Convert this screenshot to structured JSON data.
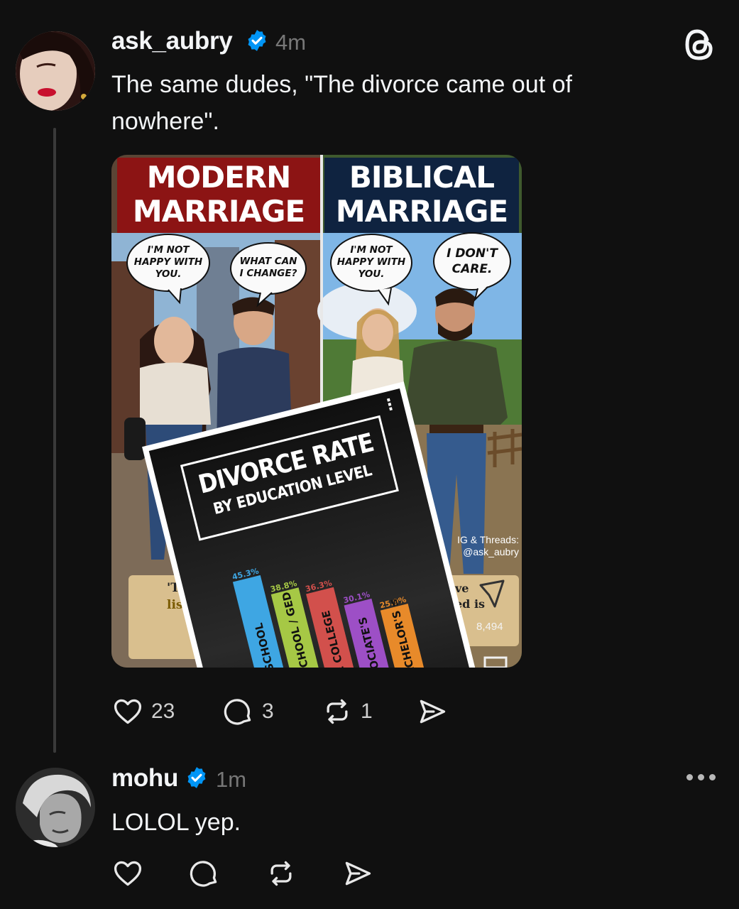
{
  "post": {
    "username": "ask_aubry",
    "time": "4m",
    "text_line1": "The same dudes, \"The divorce came out of",
    "text_line2": "nowhere\".",
    "likes": "23",
    "replies": "3",
    "reposts": "1"
  },
  "image": {
    "left_title_line1": "MODERN",
    "left_title_line2": "MARRIAGE",
    "right_title_line1": "BIBLICAL",
    "right_title_line2": "MARRIAGE",
    "bubble_left_woman_l1": "I'M NOT",
    "bubble_left_woman_l2": "HAPPY WITH",
    "bubble_left_woman_l3": "YOU.",
    "bubble_left_man_l1": "WHAT CAN",
    "bubble_left_man_l2": "I CHANGE?",
    "bubble_right_woman_l1": "I'M NOT",
    "bubble_right_woman_l2": "HAPPY WITH",
    "bubble_right_woman_l3": "YOU.",
    "bubble_right_man_l1": "I DON'T",
    "bubble_right_man_l2": "CARE.",
    "watermark_l1": "IG & Threads:",
    "watermark_l2": "@ask_aubry",
    "scroll_left_l1": "'T",
    "scroll_left_l2": "list",
    "scroll_right_l1": "ve",
    "scroll_right_l2": "ed is",
    "scroll_right_count": "8,494"
  },
  "overlay": {
    "title_line1": "DIVORCE RATE",
    "title_line2": "BY EDUCATION LEVEL",
    "menu_dots": "⋮"
  },
  "chart_data": {
    "type": "bar",
    "title": "DIVORCE RATE BY EDUCATION LEVEL",
    "categories": [
      "< HIGH SCHOOL",
      "HIGH SCHOOL / GED",
      "SOME COLLEGE",
      "ASSOCIATE'S",
      "BACHELOR'S ≤"
    ],
    "value_labels": [
      "45.3%",
      "38.8%",
      "36.3%",
      "30.1%",
      "25.9%"
    ],
    "values": [
      45.3,
      38.8,
      36.3,
      30.1,
      25.9
    ],
    "colors": [
      "#3ea6e3",
      "#a6c845",
      "#d2504c",
      "#9d4fc6",
      "#e88a2a"
    ]
  },
  "reply": {
    "username": "mohu",
    "time": "1m",
    "text": "LOLOL yep."
  },
  "colors": {
    "background": "#101010",
    "verified": "#0095f6",
    "thread_line": "#3a3a3a",
    "muted": "#777777"
  },
  "icons": {
    "like": "heart-icon",
    "reply": "comment-icon",
    "repost": "repost-icon",
    "share": "send-icon",
    "logo": "threads-logo-icon",
    "more": "more-icon"
  }
}
